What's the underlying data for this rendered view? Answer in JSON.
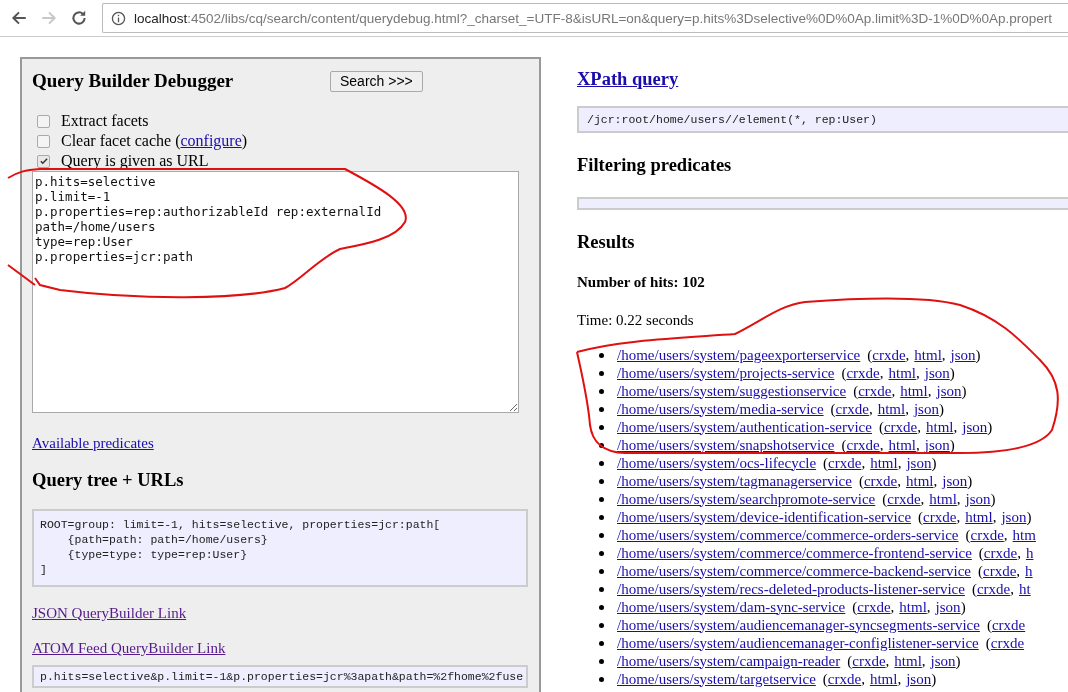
{
  "browser": {
    "back_enabled": true,
    "forward_enabled": false,
    "url_host": "localhost",
    "url_rest": ":4502/libs/cq/search/content/querydebug.html?_charset_=UTF-8&isURL=on&query=p.hits%3Dselective%0D%0Ap.limit%3D-1%0D%0Ap.propert"
  },
  "left_panel": {
    "title": "Query Builder Debugger",
    "search_button": "Search >>>",
    "options": [
      {
        "label": "Extract facets",
        "checked": false
      },
      {
        "label": "Clear facet cache (",
        "link": "configure",
        "after": ")",
        "checked": false
      },
      {
        "label": "Query is given as URL",
        "checked": true
      }
    ],
    "query_text": "p.hits=selective\np.limit=-1\np.properties=rep:authorizableId rep:externalId\npath=/home/users\ntype=rep:User\np.properties=jcr:path",
    "predicates_link": "Available predicates",
    "tree_heading": "Query tree + URLs",
    "tree_text": "ROOT=group: limit=-1, hits=selective, properties=jcr:path[\n    {path=path: path=/home/users}\n    {type=type: type=rep:User}\n]",
    "links": [
      "JSON QueryBuilder Link",
      "ATOM Feed QueryBuilder Link"
    ],
    "url_text": "p.hits=selective&p.limit=-1&p.properties=jcr%3apath&path=%2fhome%2fuse"
  },
  "right": {
    "xpath_heading": "XPath query",
    "xpath": "/jcr:root/home/users//element(*, rep:User)",
    "filtering_heading": "Filtering predicates",
    "results_heading": "Results",
    "hits": "Number of hits: 102",
    "time": "Time: 0.22 seconds",
    "punctuation": {
      "open": "(",
      "comma": ",",
      "close": ")"
    },
    "results": [
      {
        "path": "/home/users/system/pageexporterservice",
        "links": [
          "crxde",
          "html",
          "json"
        ],
        "closed": true
      },
      {
        "path": "/home/users/system/projects-service",
        "links": [
          "crxde",
          "html",
          "json"
        ],
        "closed": true
      },
      {
        "path": "/home/users/system/suggestionservice",
        "links": [
          "crxde",
          "html",
          "json"
        ],
        "closed": true
      },
      {
        "path": "/home/users/system/media-service",
        "links": [
          "crxde",
          "html",
          "json"
        ],
        "closed": true
      },
      {
        "path": "/home/users/system/authentication-service",
        "links": [
          "crxde",
          "html",
          "json"
        ],
        "closed": true
      },
      {
        "path": "/home/users/system/snapshotservice",
        "links": [
          "crxde",
          "html",
          "json"
        ],
        "closed": true
      },
      {
        "path": "/home/users/system/ocs-lifecycle",
        "links": [
          "crxde",
          "html",
          "json"
        ],
        "closed": true
      },
      {
        "path": "/home/users/system/tagmanagerservice",
        "links": [
          "crxde",
          "html",
          "json"
        ],
        "closed": true
      },
      {
        "path": "/home/users/system/searchpromote-service",
        "links": [
          "crxde",
          "html",
          "json"
        ],
        "closed": true
      },
      {
        "path": "/home/users/system/device-identification-service",
        "links": [
          "crxde",
          "html",
          "json"
        ],
        "closed": true
      },
      {
        "path": "/home/users/system/commerce/commerce-orders-service",
        "links": [
          "crxde",
          "htm"
        ],
        "closed": false
      },
      {
        "path": "/home/users/system/commerce/commerce-frontend-service",
        "links": [
          "crxde",
          "h"
        ],
        "closed": false
      },
      {
        "path": "/home/users/system/commerce/commerce-backend-service",
        "links": [
          "crxde",
          "h"
        ],
        "closed": false
      },
      {
        "path": "/home/users/system/recs-deleted-products-listener-service",
        "links": [
          "crxde",
          "ht"
        ],
        "closed": false
      },
      {
        "path": "/home/users/system/dam-sync-service",
        "links": [
          "crxde",
          "html",
          "json"
        ],
        "closed": true
      },
      {
        "path": "/home/users/system/audiencemanager-syncsegments-service",
        "links": [
          "crxde"
        ],
        "closed": false
      },
      {
        "path": "/home/users/system/audiencemanager-configlistener-service",
        "links": [
          "crxde"
        ],
        "closed": false
      },
      {
        "path": "/home/users/system/campaign-reader",
        "links": [
          "crxde",
          "html",
          "json"
        ],
        "closed": true
      },
      {
        "path": "/home/users/system/targetservice",
        "links": [
          "crxde",
          "html",
          "json"
        ],
        "closed": true
      }
    ]
  }
}
